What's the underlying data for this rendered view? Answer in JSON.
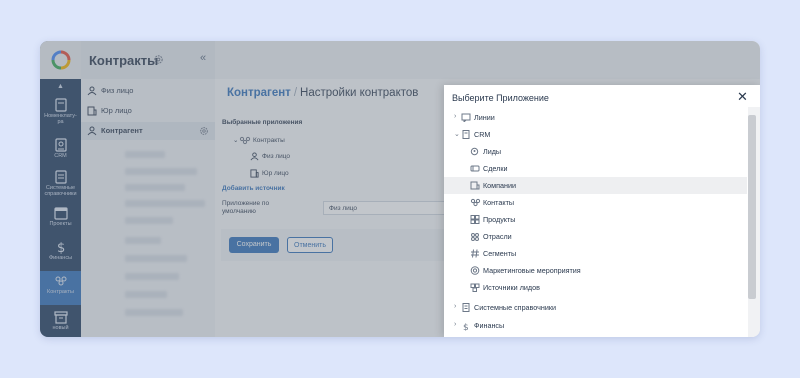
{
  "sidebar": {
    "rail": [
      {
        "label": "Номенклату-\nра",
        "icon": "book-icon"
      },
      {
        "label": "CRM",
        "icon": "contact-card-icon"
      },
      {
        "label": "Системные\nсправочники",
        "icon": "document-icon"
      },
      {
        "label": "Проекты",
        "icon": "calendar-icon"
      },
      {
        "label": "Финансы",
        "icon": "dollar-icon"
      },
      {
        "label": "Контракты",
        "icon": "people-icon"
      },
      {
        "label": "новый",
        "icon": "archive-icon"
      }
    ]
  },
  "section": {
    "title": "Контракты",
    "items": [
      {
        "label": "Физ лицо",
        "icon": "person-icon"
      },
      {
        "label": "Юр лицо",
        "icon": "building-icon"
      },
      {
        "label": "Контрагент",
        "icon": "person-icon"
      }
    ]
  },
  "page": {
    "breadcrumb": "Контрагент",
    "title": "Настройки контрактов",
    "selected_apps_label": "Выбранные приложения",
    "tree_root": "Контракты",
    "tree_children": [
      "Физ лицо",
      "Юр лицо"
    ],
    "add_source": "Добавить источник",
    "default_app_label": "Приложение по умолчанию",
    "default_app_value": "Физ лицо",
    "save": "Сохранить",
    "cancel": "Отменить"
  },
  "modal": {
    "title": "Выберите Приложение",
    "close": "✕",
    "rows": [
      {
        "label": "Линии",
        "icon": "chat-icon",
        "expand": "›",
        "level": 0
      },
      {
        "label": "CRM",
        "icon": "document-icon",
        "expand": "⌄",
        "level": 0
      },
      {
        "label": "Лиды",
        "icon": "search-person-icon",
        "expand": "",
        "level": 1
      },
      {
        "label": "Сделки",
        "icon": "handshake-icon",
        "expand": "",
        "level": 1
      },
      {
        "label": "Компании",
        "icon": "building-icon",
        "expand": "",
        "level": 1
      },
      {
        "label": "Контакты",
        "icon": "people-icon",
        "expand": "",
        "level": 1
      },
      {
        "label": "Продукты",
        "icon": "grid-icon",
        "expand": "",
        "level": 1
      },
      {
        "label": "Отрасли",
        "icon": "industry-icon",
        "expand": "",
        "level": 1
      },
      {
        "label": "Сегменты",
        "icon": "hash-icon",
        "expand": "",
        "level": 1
      },
      {
        "label": "Маркетинговые мероприятия",
        "icon": "target-icon",
        "expand": "",
        "level": 1
      },
      {
        "label": "Источники лидов",
        "icon": "funnel-icon",
        "expand": "",
        "level": 1
      },
      {
        "label": "Системные справочники",
        "icon": "document-icon",
        "expand": "›",
        "level": 0
      },
      {
        "label": "Финансы",
        "icon": "dollar-icon",
        "expand": "›",
        "level": 0
      }
    ]
  }
}
